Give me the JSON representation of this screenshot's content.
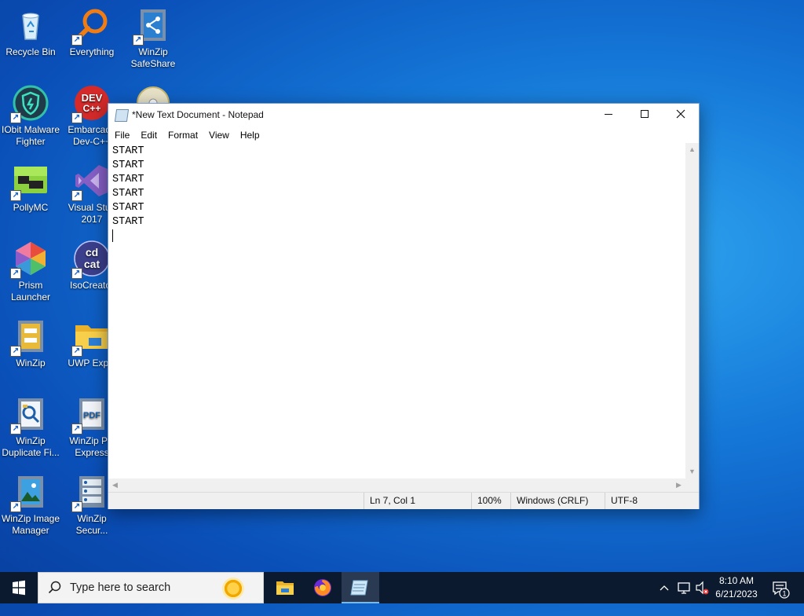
{
  "desktop": {
    "icons": [
      {
        "label": "Recycle Bin"
      },
      {
        "label": "Everything"
      },
      {
        "label": "WinZip\nSafeShare"
      },
      {
        "label": "IObit Malware\nFighter"
      },
      {
        "label": "Embarcade\nDev-C++"
      },
      {
        "label": "PollyMC"
      },
      {
        "label": "Visual Stud\n2017"
      },
      {
        "label": "Prism\nLauncher"
      },
      {
        "label": "IsoCreator"
      },
      {
        "label": "WinZip"
      },
      {
        "label": "UWP Explo"
      },
      {
        "label": "WinZip\nDuplicate Fi..."
      },
      {
        "label": "WinZip PD\nExpress"
      },
      {
        "label": "WinZip Image\nManager"
      },
      {
        "label": "WinZip\nSecur..."
      }
    ]
  },
  "notepad": {
    "title": "*New Text Document - Notepad",
    "menu": [
      "File",
      "Edit",
      "Format",
      "View",
      "Help"
    ],
    "lines": [
      "START",
      "START",
      "START",
      "START",
      "START",
      "START"
    ],
    "status": {
      "position": "Ln 7, Col 1",
      "zoom": "100%",
      "line_ending": "Windows (CRLF)",
      "encoding": "UTF-8"
    }
  },
  "taskbar": {
    "search_placeholder": "Type here to search",
    "time": "8:10 AM",
    "date": "6/21/2023",
    "notification_count": "1"
  }
}
